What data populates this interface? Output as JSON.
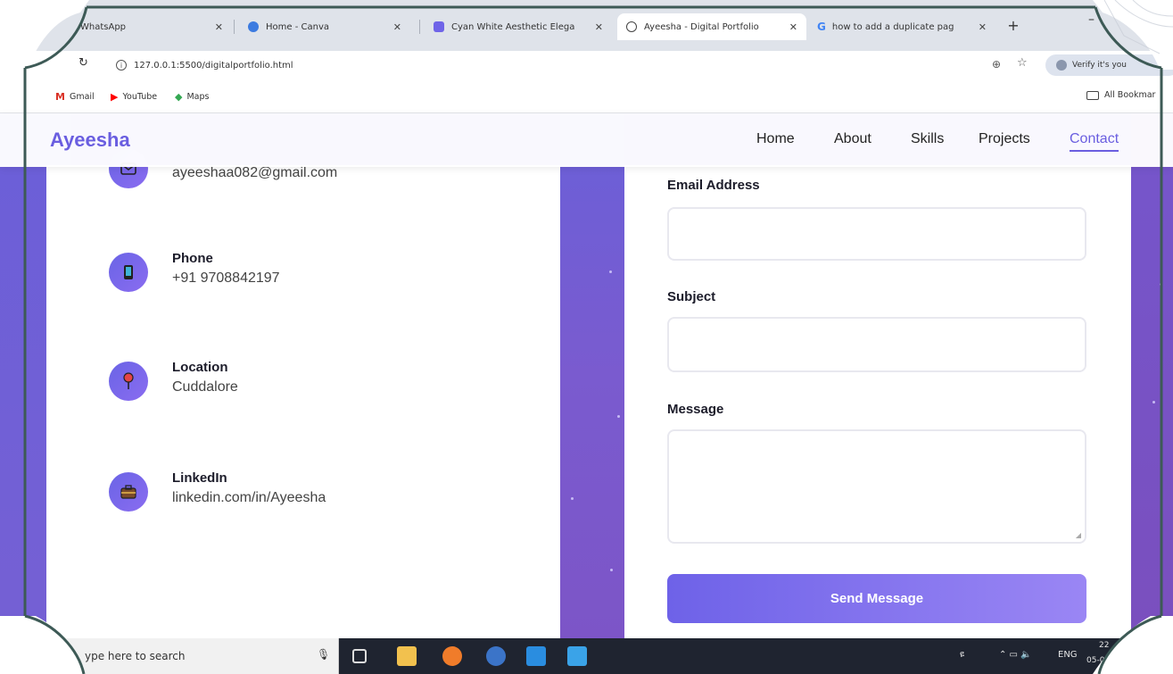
{
  "browser": {
    "tabs": [
      {
        "title": "WhatsApp",
        "icon": "whatsapp-icon",
        "color": "#25d366"
      },
      {
        "title": "Home - Canva",
        "icon": "canva-icon",
        "color": "#3c7be0"
      },
      {
        "title": "Cyan White Aesthetic Elega",
        "icon": "canva-design-icon",
        "color": "#6f64e8"
      },
      {
        "title": "Ayeesha - Digital Portfolio",
        "icon": "globe-icon",
        "color": "#555555"
      },
      {
        "title": "how to add a duplicate pag",
        "icon": "google-icon",
        "color": "#4285f4"
      }
    ],
    "new_tab": "+",
    "minimize": "–",
    "url": "127.0.0.1:5500/digitalportfolio.html",
    "verify_label": "Verify it's you",
    "bookmarks": [
      {
        "label": "Gmail",
        "icon": "gmail-icon"
      },
      {
        "label": "YouTube",
        "icon": "youtube-icon"
      },
      {
        "label": "Maps",
        "icon": "maps-icon"
      }
    ],
    "all_bookmarks": "All Bookmar"
  },
  "site": {
    "brand": "Ayeesha",
    "nav": [
      "Home",
      "About",
      "Skills",
      "Projects",
      "Contact"
    ],
    "active_nav": "Contact",
    "contact_info": {
      "email": "ayeeshaa082@gmail.com",
      "phone_title": "Phone",
      "phone_value": "+91 9708842197",
      "location_title": "Location",
      "location_value": "Cuddalore",
      "linkedin_title": "LinkedIn",
      "linkedin_value": "linkedin.com/in/Ayeesha"
    },
    "form": {
      "email_label": "Email Address",
      "subject_label": "Subject",
      "message_label": "Message",
      "send_label": "Send Message"
    },
    "accent_color": "#6a5ee0"
  },
  "taskbar": {
    "search_placeholder": "ype here to search",
    "tray_text": "ENG",
    "clock_top": "22",
    "clock_bottom": "05-0"
  }
}
